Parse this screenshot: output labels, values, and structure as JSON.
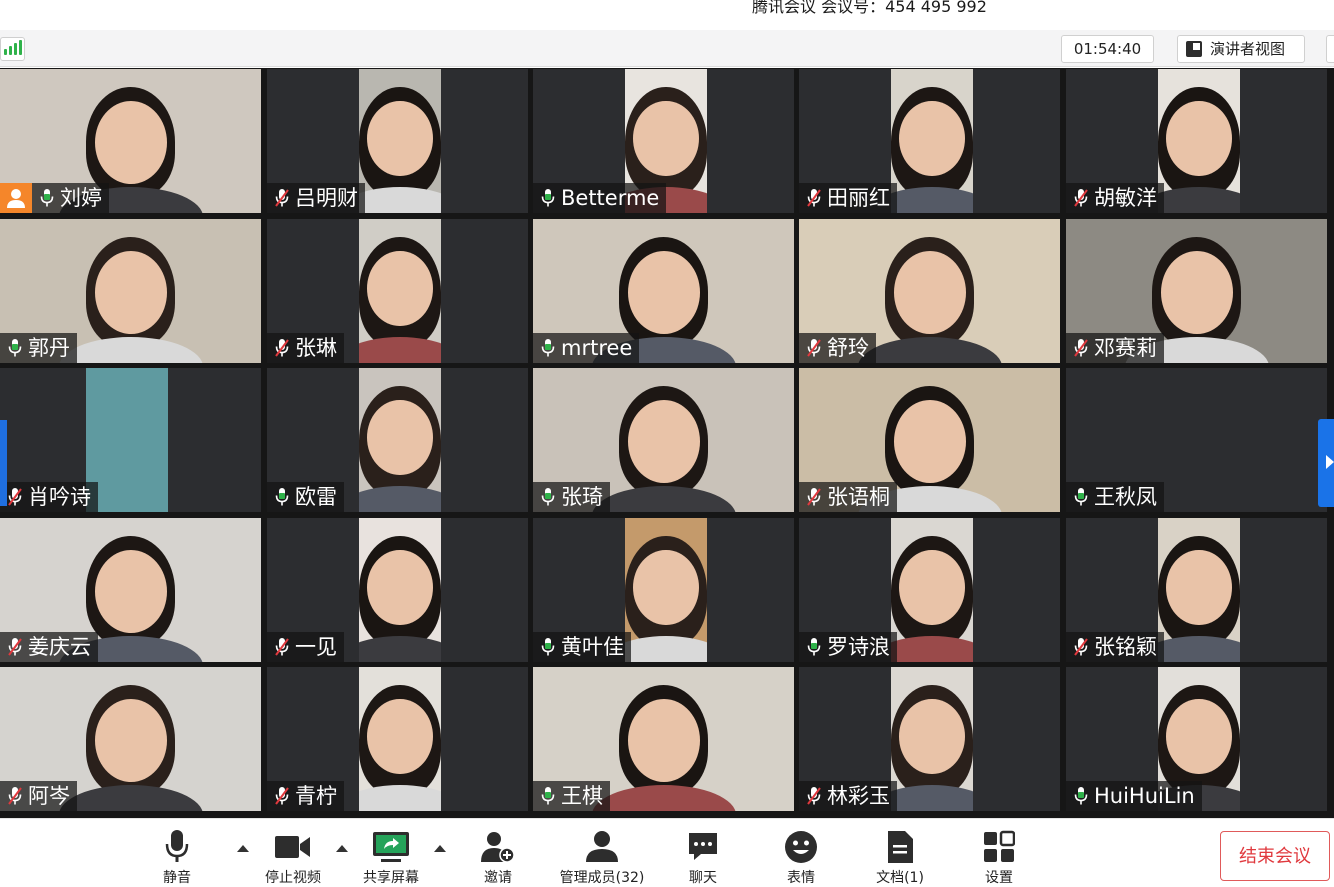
{
  "title": "腾讯会议 会议号：454 495 992",
  "info_bar": {
    "timer": "01:54:40",
    "speaker_view_label": "演讲者视图"
  },
  "participants": [
    {
      "name": "刘婷",
      "mic": "on",
      "host": true
    },
    {
      "name": "吕明财",
      "mic": "muted"
    },
    {
      "name": "Betterme",
      "mic": "on"
    },
    {
      "name": "田丽红",
      "mic": "muted"
    },
    {
      "name": "胡敏洋",
      "mic": "muted"
    },
    {
      "name": "郭丹",
      "mic": "on"
    },
    {
      "name": "张琳",
      "mic": "muted"
    },
    {
      "name": "mrtree",
      "mic": "on"
    },
    {
      "name": "舒玲",
      "mic": "muted"
    },
    {
      "name": "邓赛莉",
      "mic": "muted"
    },
    {
      "name": "肖吟诗",
      "mic": "muted"
    },
    {
      "name": "欧雷",
      "mic": "on"
    },
    {
      "name": "张琦",
      "mic": "on"
    },
    {
      "name": "张语桐",
      "mic": "muted"
    },
    {
      "name": "王秋凤",
      "mic": "on"
    },
    {
      "name": "姜庆云",
      "mic": "muted"
    },
    {
      "name": "一见",
      "mic": "muted"
    },
    {
      "name": "黄叶佳",
      "mic": "on"
    },
    {
      "name": "罗诗浪",
      "mic": "on"
    },
    {
      "name": "张铭颖",
      "mic": "muted"
    },
    {
      "name": "阿岑",
      "mic": "muted"
    },
    {
      "name": "青柠",
      "mic": "muted"
    },
    {
      "name": "王棋",
      "mic": "on"
    },
    {
      "name": "林彩玉",
      "mic": "muted"
    },
    {
      "name": "HuiHuiLin",
      "mic": "on"
    }
  ],
  "toolbar": {
    "mute": "静音",
    "stop_video": "停止视频",
    "share_screen": "共享屏幕",
    "invite": "邀请",
    "manage_members": "管理成员(32)",
    "chat": "聊天",
    "reactions": "表情",
    "documents": "文档(1)",
    "settings": "设置",
    "end_meeting": "结束会议"
  },
  "colors": {
    "accent": "#1a73e8",
    "end_meeting": "#e0393e",
    "host_badge": "#f5862a",
    "mic_on": "#2fb24a",
    "mic_muted": "#e0393e"
  }
}
